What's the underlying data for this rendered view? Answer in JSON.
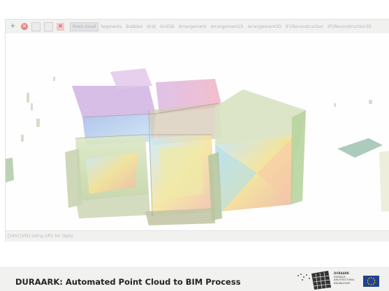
{
  "toolbar": {
    "icons": [
      "plus-icon",
      "stop-icon",
      "blank-button-icon",
      "blank-button-icon",
      "close-icon"
    ],
    "tabs": [
      {
        "label": "Point cloud",
        "active": true
      },
      {
        "label": "Segments",
        "active": false
      },
      {
        "label": "Bubbles",
        "active": false
      },
      {
        "label": "Grid",
        "active": false
      },
      {
        "label": "Grid3D",
        "active": false
      },
      {
        "label": "Arrangement",
        "active": false
      },
      {
        "label": "Arrangement25",
        "active": false
      },
      {
        "label": "Arrangement3D",
        "active": false
      },
      {
        "label": "IFCReconstruction",
        "active": false
      },
      {
        "label": "IFCReconstruction3D",
        "active": false
      }
    ]
  },
  "status": {
    "text": "[info] [VIS] Using GPU for Optix"
  },
  "footer": {
    "title": "DURAARK: Automated Point Cloud to BIM Process",
    "logo_lines": [
      "DURAARK",
      "DURABLE",
      "ARCHITECTURAL",
      "KNOWLEDGE"
    ]
  },
  "colors": {
    "footer_bg": "#f1f1ef",
    "toolbar_bg": "#f1f1ef",
    "eu_blue": "#21418f",
    "eu_star": "#ffdd00"
  }
}
